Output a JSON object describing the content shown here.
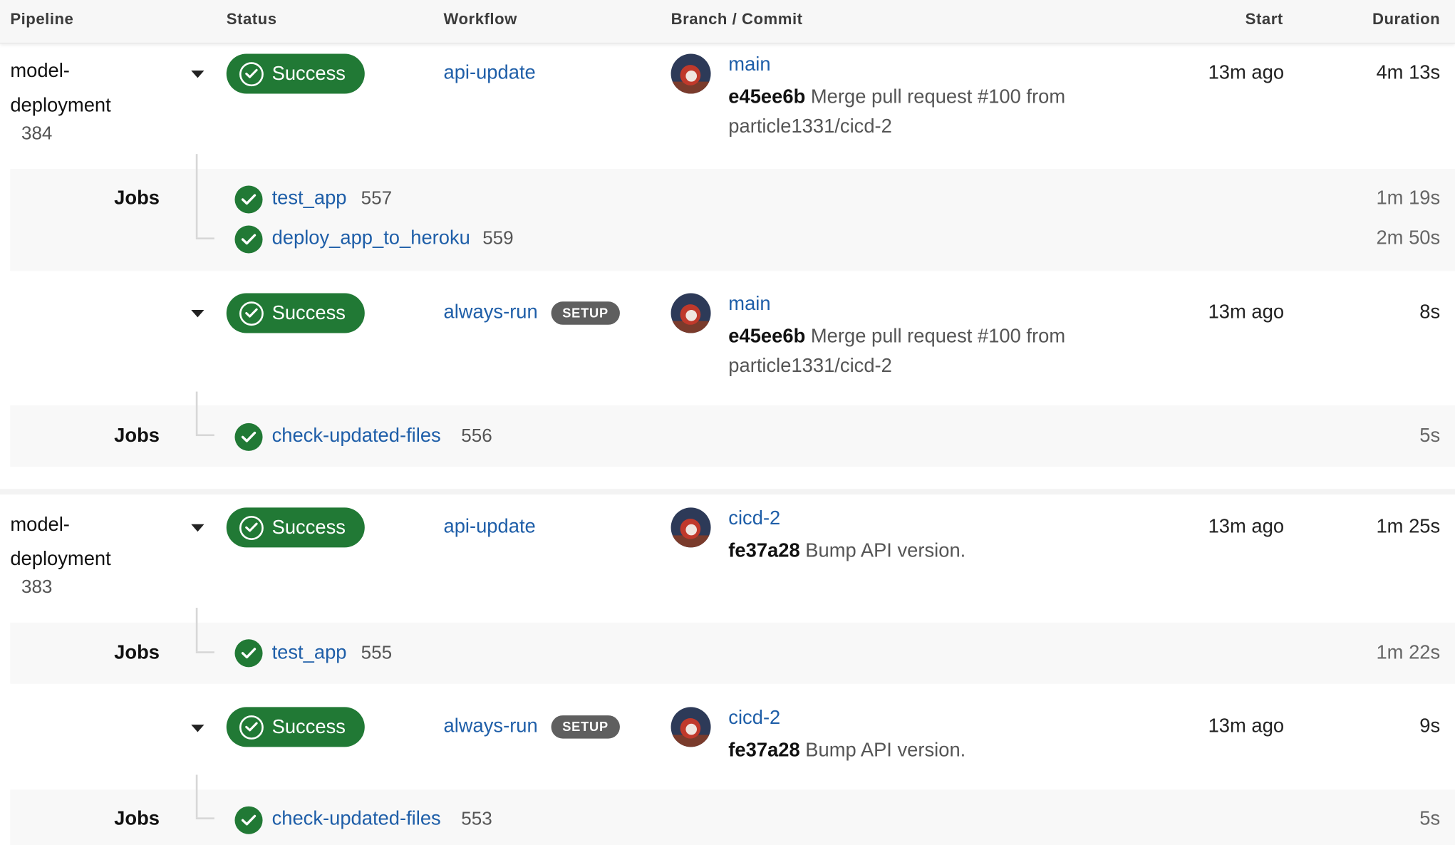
{
  "columns": {
    "pipeline": "Pipeline",
    "status": "Status",
    "workflow": "Workflow",
    "branch_commit": "Branch / Commit",
    "start": "Start",
    "duration": "Duration"
  },
  "icons": {
    "status": "check-circle-icon",
    "expand": "caret-down-icon"
  },
  "colors": {
    "success": "#217935",
    "link": "#1e5ea8",
    "badge": "#5f5f5f"
  },
  "pipelines": [
    {
      "project": "model-deployment",
      "project_line1": "model-",
      "project_line2": "deployment",
      "number": "384",
      "workflows": [
        {
          "status": "Success",
          "name": "api-update",
          "badge": "",
          "branch": "main",
          "sha": "e45ee6b",
          "message": "Merge pull request #100 from particle1331/cicd-2",
          "start": "13m ago",
          "duration": "4m 13s",
          "jobs_label": "Jobs",
          "jobs": [
            {
              "name": "test_app",
              "number": "557",
              "duration": "1m 19s"
            },
            {
              "name": "deploy_app_to_heroku",
              "number": "559",
              "duration": "2m 50s"
            }
          ]
        },
        {
          "status": "Success",
          "name": "always-run",
          "badge": "SETUP",
          "branch": "main",
          "sha": "e45ee6b",
          "message": "Merge pull request #100 from particle1331/cicd-2",
          "start": "13m ago",
          "duration": "8s",
          "jobs_label": "Jobs",
          "jobs": [
            {
              "name": "check-updated-files",
              "number": "556",
              "duration": "5s"
            }
          ]
        }
      ]
    },
    {
      "project": "model-deployment",
      "project_line1": "model-",
      "project_line2": "deployment",
      "number": "383",
      "workflows": [
        {
          "status": "Success",
          "name": "api-update",
          "badge": "",
          "branch": "cicd-2",
          "sha": "fe37a28",
          "message": "Bump API version.",
          "start": "13m ago",
          "duration": "1m 25s",
          "jobs_label": "Jobs",
          "jobs": [
            {
              "name": "test_app",
              "number": "555",
              "duration": "1m 22s"
            }
          ]
        },
        {
          "status": "Success",
          "name": "always-run",
          "badge": "SETUP",
          "branch": "cicd-2",
          "sha": "fe37a28",
          "message": "Bump API version.",
          "start": "13m ago",
          "duration": "9s",
          "jobs_label": "Jobs",
          "jobs": [
            {
              "name": "check-updated-files",
              "number": "553",
              "duration": "5s"
            }
          ]
        }
      ]
    }
  ]
}
